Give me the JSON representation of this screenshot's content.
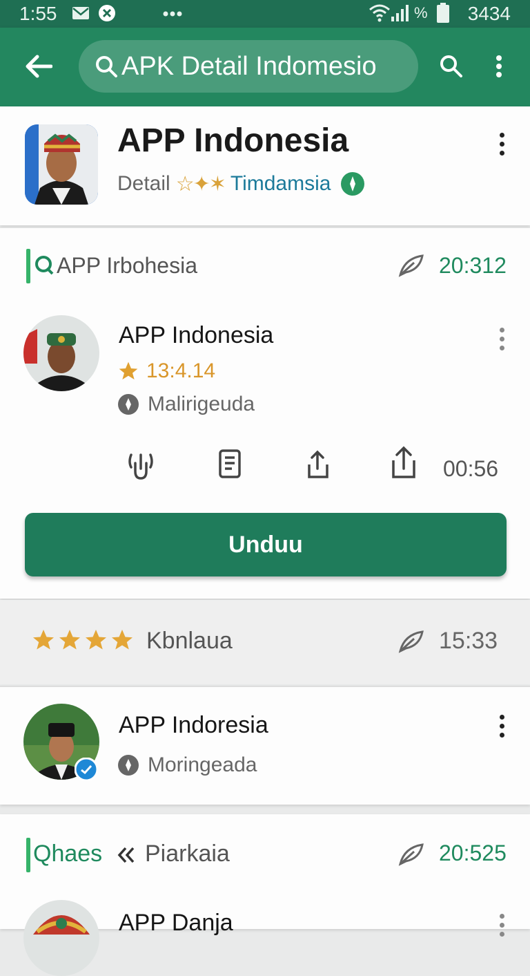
{
  "status_bar": {
    "time": "1:55",
    "right_text": "3434",
    "icons": [
      "mail-icon",
      "x-badge-icon",
      "more-dots-icon",
      "wifi-icon",
      "signal-icon",
      "percent-icon",
      "battery-icon"
    ]
  },
  "app_bar": {
    "search_text": "APK Detail Indomesio",
    "icons": [
      "back-arrow-icon",
      "search-icon",
      "overflow-menu-icon"
    ]
  },
  "header": {
    "title": "APP Indonesia",
    "subtitle_prefix": "Detail",
    "subtitle_link": "Timdamsia"
  },
  "sections": [
    {
      "label": "APP Irbohesia",
      "time": "20:312",
      "item": {
        "name": "APP Indonesia",
        "rating": "13:4.14",
        "location": "Malirigeuda",
        "actions": [
          "touch-icon",
          "document-icon",
          "share-icon",
          "upload-icon"
        ],
        "duration": "00:56",
        "button_label": "Unduu"
      }
    },
    {
      "label": "Kbnlaua",
      "time": "15:33",
      "stars": 4,
      "item": {
        "name": "APP Indoresia",
        "location": "Moringeada"
      }
    },
    {
      "label": "Qhaes",
      "label2": "Piarkaia",
      "time": "20:525",
      "item": {
        "name": "APP Danja"
      }
    }
  ],
  "colors": {
    "status_bar": "#1f6f53",
    "app_bar": "#23875f",
    "primary_button": "#1f7c5b",
    "accent_green": "#1f8a5e",
    "star": "#e0a030"
  }
}
